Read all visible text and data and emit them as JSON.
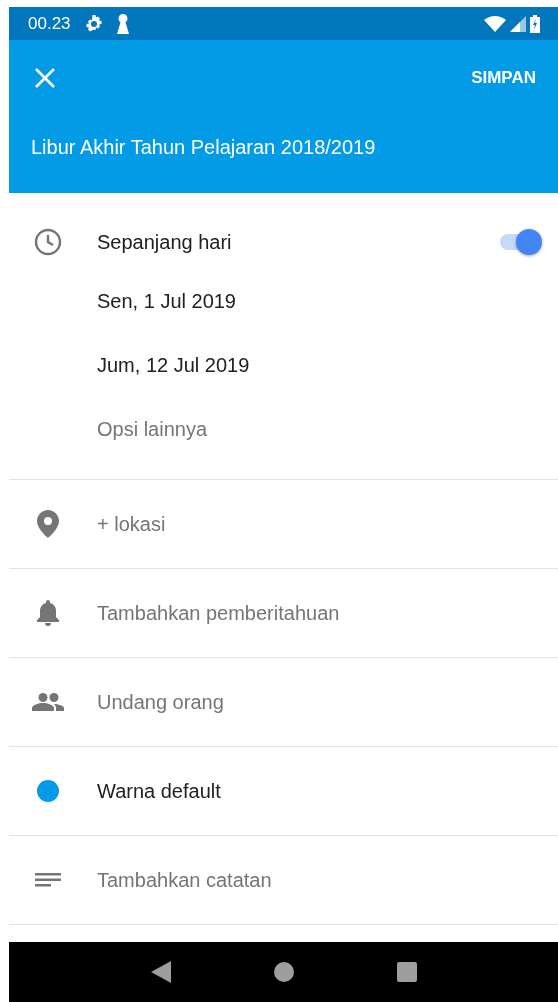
{
  "status_bar": {
    "time": "00.23"
  },
  "app_bar": {
    "save_label": "SIMPAN",
    "title": "Libur Akhir Tahun Pelajaran 2018/2019"
  },
  "all_day": {
    "label": "Sepanjang hari",
    "on": true
  },
  "dates": [
    {
      "label": "Sen, 1 Jul 2019"
    },
    {
      "label": "Jum, 12 Jul 2019"
    }
  ],
  "more_options": "Opsi lainnya",
  "rows": [
    {
      "kind": "location",
      "label": "+ lokasi",
      "filled": false
    },
    {
      "kind": "notification",
      "label": "Tambahkan pemberitahuan",
      "filled": false
    },
    {
      "kind": "people",
      "label": "Undang orang",
      "filled": false
    },
    {
      "kind": "color",
      "label": "Warna default",
      "filled": true,
      "color": "#039be5"
    },
    {
      "kind": "notes",
      "label": "Tambahkan catatan",
      "filled": false
    }
  ]
}
